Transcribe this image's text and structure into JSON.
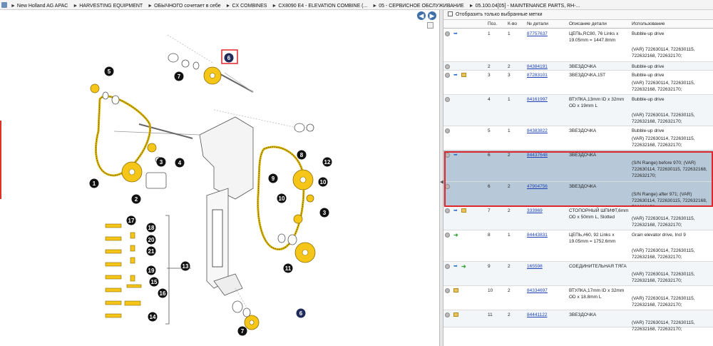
{
  "breadcrumb": [
    "New Holland AG APAC",
    "HARVESTING EQUIPMENT",
    "ОБЫЧНОГО сочетает в себе",
    "CX COMBINES",
    "CX8090 E4 - ELEVATION COMBINE (...",
    "05 - СЕРВИСНОЕ ОБСЛУЖИВАНИЕ",
    "05.100.04[05] - MAINTENANCE PARTS, RH-..."
  ],
  "viewer": {
    "nav_back": "◀",
    "nav_forward": "▶",
    "callouts": [
      "5",
      "7",
      "8",
      "6",
      "1",
      "2",
      "3",
      "4",
      "9",
      "10",
      "12",
      "10",
      "3",
      "11",
      "13",
      "17",
      "18",
      "20",
      "21",
      "19",
      "15",
      "16",
      "14",
      "7",
      "6"
    ]
  },
  "filter": {
    "label": "Отобразить только выбранные метки"
  },
  "columns": {
    "pos": "Поз.",
    "qty": "К-во",
    "part": "№ детали",
    "desc": "Описание детали",
    "usage": "Использование"
  },
  "rows": [
    {
      "pos": "1",
      "qty": "1",
      "part": "87757637",
      "desc": "ЦЕПЬ,RC80, 76 Links x 19.05mm = 1447.8mm",
      "usage": "Bubble-up drive",
      "var": "(VAR) 722630114, 722630115, 722632168, 722632170;"
    },
    {
      "pos": "2",
      "qty": "2",
      "part": "84384191",
      "desc": "ЗВЕЗДОЧКА",
      "usage": "Bubble-up drive",
      "var": ""
    },
    {
      "pos": "3",
      "qty": "3",
      "part": "87283101",
      "desc": "ЗВЕЗДОЧКА,15T",
      "usage": "Bubble-up drive",
      "var": "(VAR) 722630114, 722630115, 722632168, 722632170;"
    },
    {
      "pos": "4",
      "qty": "1",
      "part": "84161997",
      "desc": "ВТУЛКА,13mm ID x 32mm OD x 19mm L",
      "usage": "Bubble-up drive",
      "var": "(VAR) 722630114, 722630115, 722632168, 722632170;"
    },
    {
      "pos": "5",
      "qty": "1",
      "part": "84383822",
      "desc": "ЗВЕЗДОЧКА",
      "usage": "Bubble-up drive",
      "var": "(VAR) 722630114, 722630115, 722632168, 722632170;"
    },
    {
      "pos": "6",
      "qty": "2",
      "part": "84437648",
      "desc": "ЗВЕЗДОЧКА",
      "usage": "",
      "var": "(S/N Range) before 970; (VAR) 722630114, 722630115, 722632168, 722632170;"
    },
    {
      "pos": "6",
      "qty": "2",
      "part": "47904756",
      "desc": "ЗВЕЗДОЧКА",
      "usage": "",
      "var": "(S/N Range) after 971; (VAR) 722630114, 722630115, 722632168, 722632170;"
    },
    {
      "pos": "7",
      "qty": "2",
      "part": "333969",
      "desc": "СТОПОРНЫЙ ШПИФТ,6mm OD x 50mm L, Slotted",
      "usage": "",
      "var": "(VAR) 722630114, 722630115, 722632168, 722632170;"
    },
    {
      "pos": "8",
      "qty": "1",
      "part": "84443831",
      "desc": "ЦЕПЬ,#60, 92 Links x 19.05mm = 1752.6mm",
      "usage": "Grain elevator drive, Incl 9",
      "var": "(VAR) 722630114, 722630115, 722632168, 722632170;"
    },
    {
      "pos": "9",
      "qty": "2",
      "part": "165598",
      "desc": "СОЕДИНИТЕЛЬНАЯ ТЯГА",
      "usage": "",
      "var": "(VAR) 722630114, 722630115, 722632168, 722632170;"
    },
    {
      "pos": "10",
      "qty": "2",
      "part": "84334697",
      "desc": "ВТУЛКА,17mm ID x 32mm OD x 18.8mm L",
      "usage": "",
      "var": "(VAR) 722630114, 722630115, 722632168, 722632170;"
    },
    {
      "pos": "11",
      "qty": "2",
      "part": "84441122",
      "desc": "ЗВЕЗДОЧКА",
      "usage": "",
      "var": "(VAR) 722630114, 722630115, 722632168, 722632170;"
    }
  ]
}
